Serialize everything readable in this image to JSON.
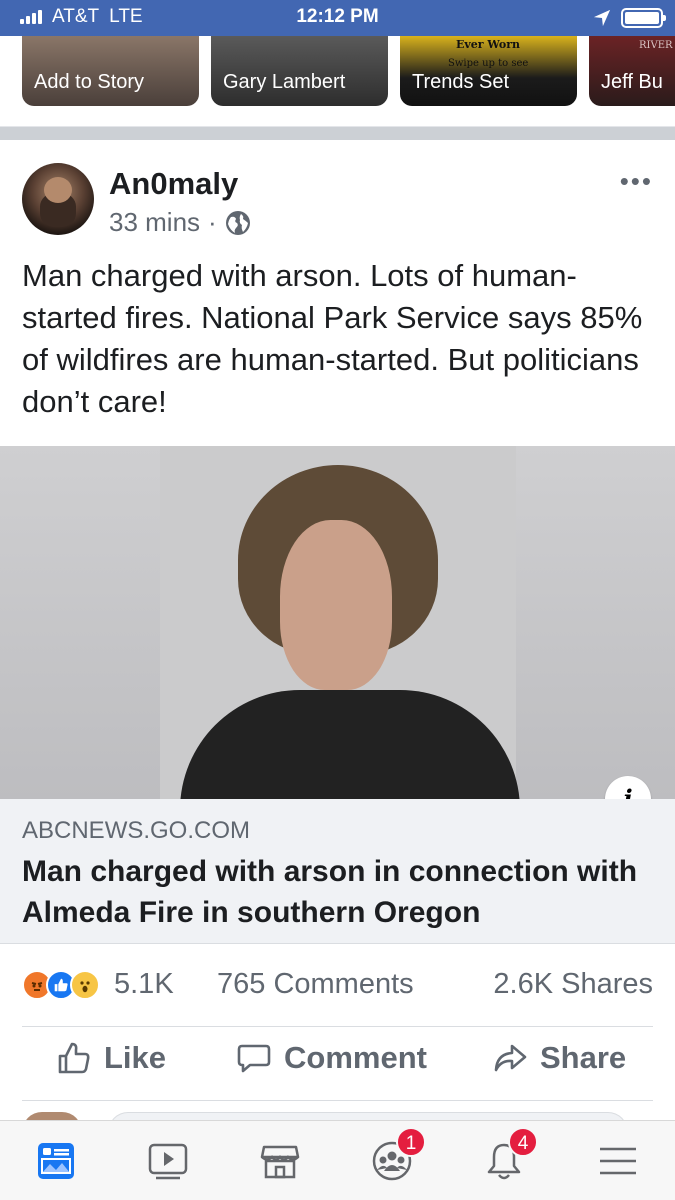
{
  "status_bar": {
    "carrier": "AT&T",
    "network": "LTE",
    "time": "12:12 PM"
  },
  "stories": [
    {
      "label": "Add to Story"
    },
    {
      "label": "Gary Lambert"
    },
    {
      "label": "Trends Set",
      "overlay_title": "Ever Worn",
      "overlay_sub": "Swipe up to see"
    },
    {
      "label": "Jeff Bu",
      "overlay_title": "RIVER"
    }
  ],
  "post": {
    "author": "An0maly",
    "time": "33 mins",
    "privacy_icon": "globe-icon",
    "text": "Man charged with arson. Lots of human-started fires. National Park Service says 85% of wildfires are human-started. But politicians don’t care!",
    "link": {
      "domain": "ABCNEWS.GO.COM",
      "title": "Man charged with arson in connection with Almeda Fire in southern Oregon",
      "info_glyph": "i"
    },
    "reactions": {
      "types": [
        "angry",
        "like",
        "wow"
      ],
      "count": "5.1K"
    },
    "comments": "765 Comments",
    "shares": "2.6K Shares",
    "actions": {
      "like": "Like",
      "comment": "Comment",
      "share": "Share"
    }
  },
  "tabbar": {
    "tabs": [
      {
        "icon": "news-feed-icon",
        "active": true
      },
      {
        "icon": "watch-icon"
      },
      {
        "icon": "marketplace-icon"
      },
      {
        "icon": "groups-icon",
        "badge": "1"
      },
      {
        "icon": "notifications-icon",
        "badge": "4"
      },
      {
        "icon": "menu-icon"
      }
    ]
  },
  "colors": {
    "brand_blue": "#4267b2",
    "badge_red": "#e41e3f",
    "secondary_text": "#606770"
  }
}
